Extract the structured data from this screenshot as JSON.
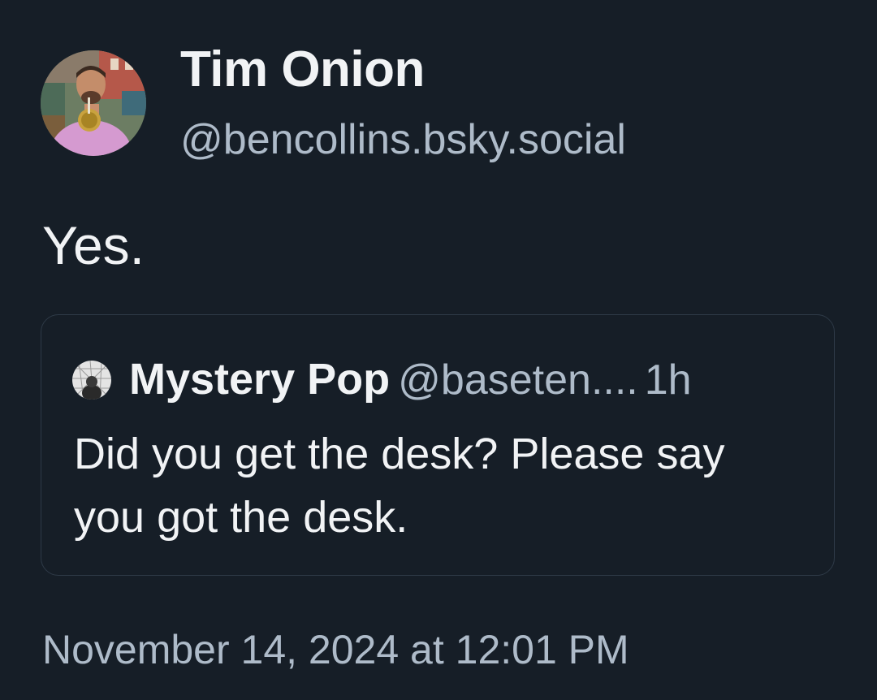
{
  "post": {
    "author": {
      "display_name": "Tim Onion",
      "handle": "@bencollins.bsky.social",
      "avatar_icon": "user-avatar-photo"
    },
    "text": "Yes.",
    "quoted_post": {
      "author_name": "Mystery Pop",
      "author_handle": "@baseten....",
      "time_ago": "1h",
      "avatar_icon": "user-avatar-photo",
      "text": "Did you get the desk? Please say you got the desk."
    },
    "timestamp": "November 14, 2024 at 12:01 PM"
  },
  "colors": {
    "background": "#161e27",
    "primary_text": "#f1f3f5",
    "secondary_text": "#aebbc9",
    "card_border": "#2e3a47"
  }
}
